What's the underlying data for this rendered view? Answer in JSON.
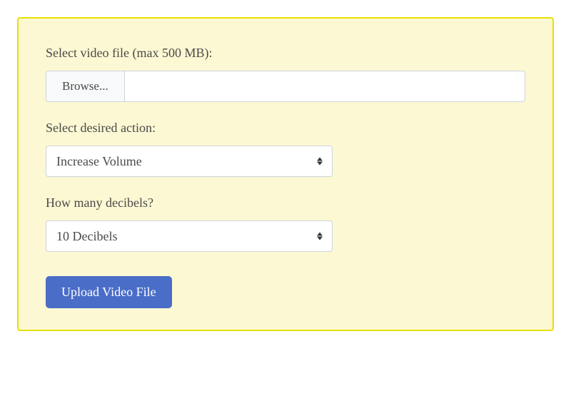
{
  "form": {
    "file": {
      "label": "Select video file (max 500 MB):",
      "browse_label": "Browse...",
      "filename": ""
    },
    "action": {
      "label": "Select desired action:",
      "selected": "Increase Volume"
    },
    "decibels": {
      "label": "How many decibels?",
      "selected": "10 Decibels"
    },
    "submit_label": "Upload Video File"
  }
}
